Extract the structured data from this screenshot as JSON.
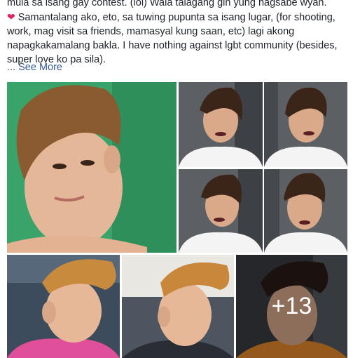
{
  "post": {
    "line1": "mula sa isang gay contest. (lol) Wala talagang gin yung nagsabe wyan.",
    "line2": "Samantalang ako, eto, sa tuwing pupunta sa isang lugar, (for shooting,",
    "line3": "work, mag visit sa friends, mamasyal kung saan, etc) lagi akong",
    "line4": "napagkakamalang bakla. I have nothing against lgbt community (besides,",
    "line5": "super love ko pa sila).",
    "see_more_prefix": "... ",
    "see_more": "See More"
  },
  "photos": {
    "more_count": "+13",
    "colors": {
      "green_bg": "#2e9e5e",
      "hair_brown": "#7a4a25",
      "skin": "#e7b99a",
      "shirt_white": "#f4f4f4",
      "lip_dark": "#5a1f24",
      "pink_shirt": "#e0509a",
      "overlay_text": "#ffffff"
    }
  }
}
